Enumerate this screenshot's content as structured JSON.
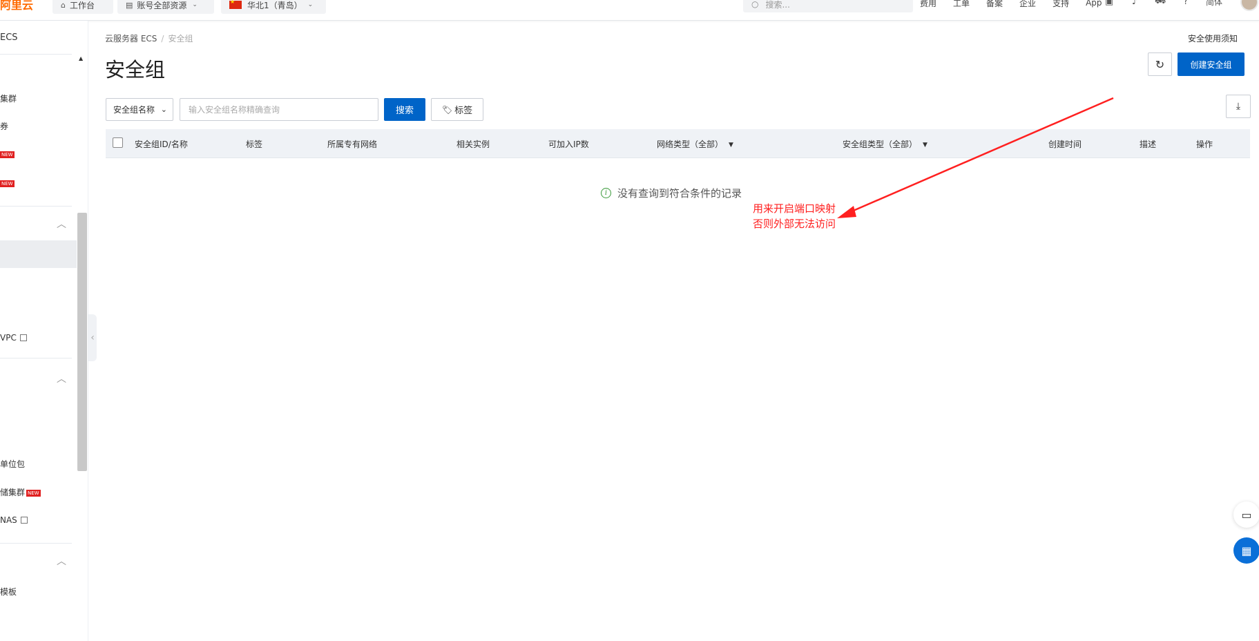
{
  "topbar": {
    "logo": "阿里云",
    "workbench": "工作台",
    "resources": "账号全部资源",
    "region": "华北1（青岛）",
    "search_placeholder": "搜索...",
    "links": [
      "费用",
      "工单",
      "备案",
      "企业",
      "支持",
      "App"
    ],
    "icons": [
      "terminal-icon",
      "bell-icon",
      "cart-icon",
      "help-icon"
    ],
    "language": "简体"
  },
  "sidebar": {
    "title": "ECS",
    "items": {
      "cluster": "集群",
      "coupon": "券",
      "new_badge": "NEW",
      "vpc": "VPC",
      "unit_pack": "单位包",
      "storage_cluster": "储集群",
      "nas": "NAS",
      "template": "模板"
    }
  },
  "breadcrumb": {
    "root": "云服务器 ECS",
    "current": "安全组"
  },
  "notice_link": "安全使用须知",
  "page_title": "安全组",
  "create_button": "创建安全组",
  "filter": {
    "select_value": "安全组名称",
    "input_placeholder": "输入安全组名称精确查询",
    "search_button": "搜索",
    "tag_button": "标签"
  },
  "table": {
    "columns": [
      "安全组ID/名称",
      "标签",
      "所属专有网络",
      "相关实例",
      "可加入IP数",
      "网络类型（全部）",
      "安全组类型（全部）",
      "创建时间",
      "描述",
      "操作"
    ],
    "empty_text": "没有查询到符合条件的记录"
  },
  "annotation": {
    "line1": "用来开启端口映射",
    "line2": "否则外部无法访问",
    "color": "#ff2020"
  },
  "colors": {
    "primary": "#0064c8",
    "brand": "#ff6a00"
  }
}
